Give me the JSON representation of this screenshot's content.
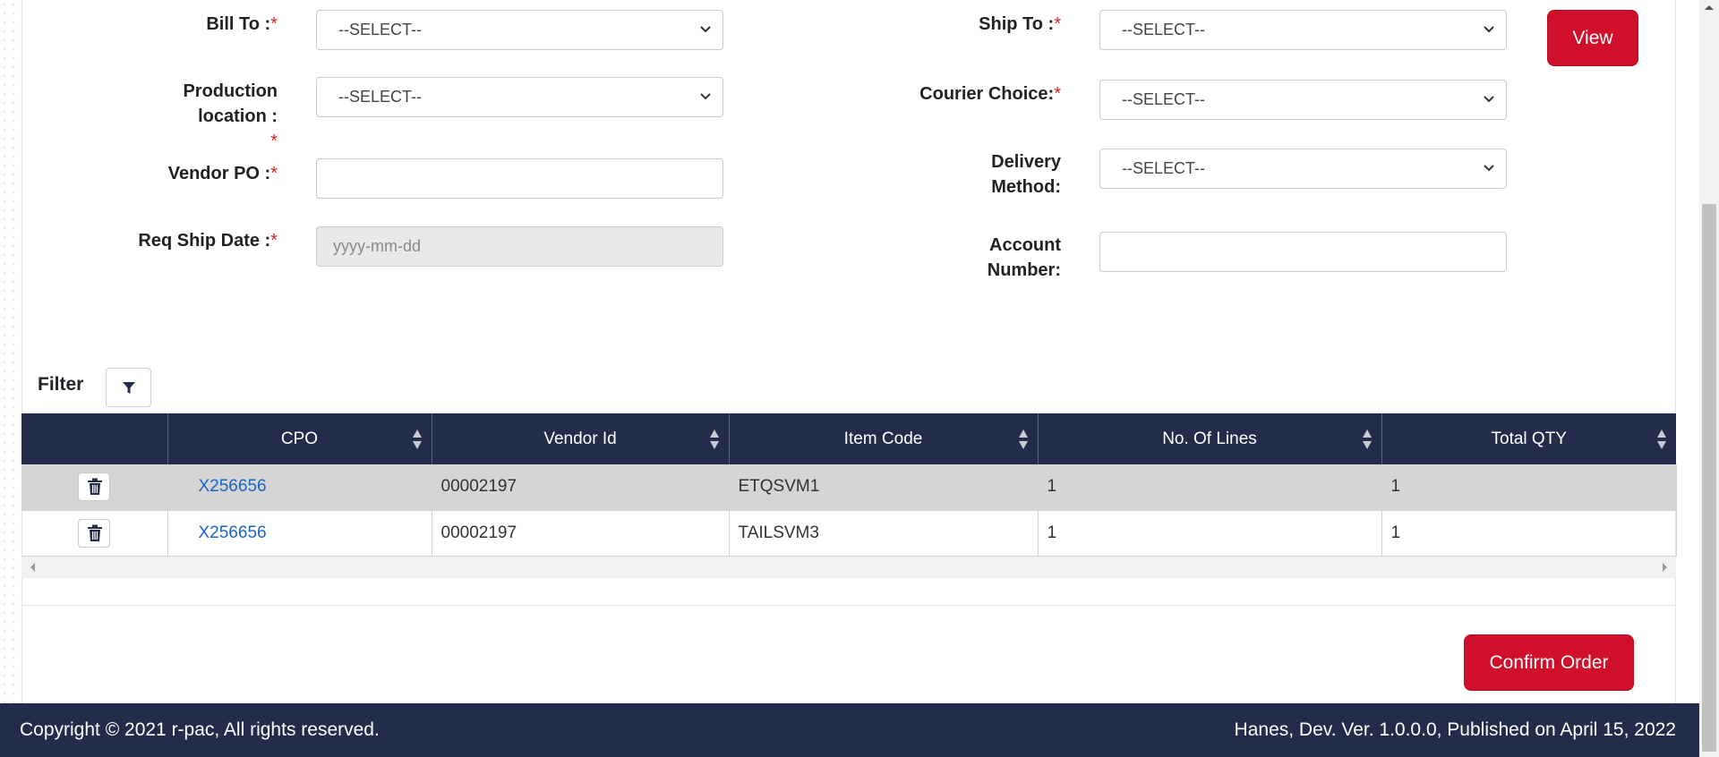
{
  "form": {
    "bill_to": {
      "label": "Bill To :",
      "req": "*",
      "value": "--SELECT--"
    },
    "production_location": {
      "label_line1": "Production",
      "label_line2": "location :",
      "req": "*",
      "value": "--SELECT--"
    },
    "vendor_po": {
      "label": "Vendor PO :",
      "req": "*",
      "value": ""
    },
    "req_ship_date": {
      "label": "Req Ship Date :",
      "req": "*",
      "placeholder": "yyyy-mm-dd"
    },
    "ship_to": {
      "label": "Ship To :",
      "req": "*",
      "value": "--SELECT--"
    },
    "courier_choice": {
      "label": "Courier Choice:",
      "req": "*",
      "value": "--SELECT--"
    },
    "delivery_method": {
      "label_line1": "Delivery",
      "label_line2": "Method:",
      "value": "--SELECT--"
    },
    "account_number": {
      "label_line1": "Account",
      "label_line2": "Number:",
      "value": ""
    },
    "view_button": "View"
  },
  "filter": {
    "label": "Filter"
  },
  "table": {
    "columns": [
      "",
      "CPO",
      "Vendor Id",
      "Item Code",
      "No. Of Lines",
      "Total QTY"
    ],
    "rows": [
      {
        "cpo": "X256656",
        "vendor_id": "00002197",
        "item_code": "ETQSVM1",
        "lines": "1",
        "qty": "1"
      },
      {
        "cpo": "X256656",
        "vendor_id": "00002197",
        "item_code": "TAILSVM3",
        "lines": "1",
        "qty": "1"
      }
    ]
  },
  "confirm_button": "Confirm Order",
  "footer": {
    "left": "Copyright © 2021 r-pac, All rights reserved.",
    "right": "Hanes, Dev. Ver. 1.0.0.0, Published on April 15, 2022"
  },
  "colors": {
    "accent_red": "#d0102a",
    "navy": "#232d4b",
    "link_blue": "#1a64c8"
  },
  "icons": [
    "chevron-down-icon",
    "filter-icon",
    "sort-icon",
    "trash-icon",
    "scroll-left-icon",
    "scroll-right-icon",
    "scroll-up-icon"
  ]
}
